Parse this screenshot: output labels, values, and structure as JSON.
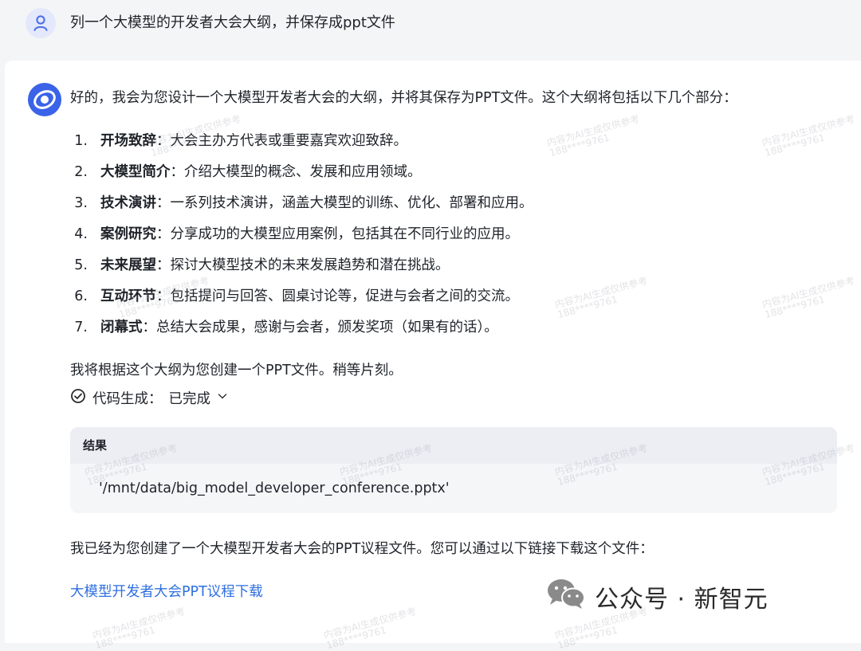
{
  "user": {
    "message": "列一个大模型的开发者大会大纲，并保存成ppt文件"
  },
  "assistant": {
    "intro": "好的，我会为您设计一个大模型开发者大会的大纲，并将其保存为PPT文件。这个大纲将包括以下几个部分：",
    "outline": [
      {
        "num": "1.",
        "term": "开场致辞",
        "desc": "：大会主办方代表或重要嘉宾欢迎致辞。"
      },
      {
        "num": "2.",
        "term": "大模型简介",
        "desc": "：介绍大模型的概念、发展和应用领域。"
      },
      {
        "num": "3.",
        "term": "技术演讲",
        "desc": "：一系列技术演讲，涵盖大模型的训练、优化、部署和应用。"
      },
      {
        "num": "4.",
        "term": "案例研究",
        "desc": "：分享成功的大模型应用案例，包括其在不同行业的应用。"
      },
      {
        "num": "5.",
        "term": "未来展望",
        "desc": "：探讨大模型技术的未来发展趋势和潜在挑战。"
      },
      {
        "num": "6.",
        "term": "互动环节",
        "desc": "：包括提问与回答、圆桌讨论等，促进与会者之间的交流。"
      },
      {
        "num": "7.",
        "term": "闭幕式",
        "desc": "：总结大会成果，感谢与会者，颁发奖项（如果有的话）。"
      }
    ],
    "wait_text": "我将根据这个大纲为您创建一个PPT文件。稍等片刻。",
    "code_status": {
      "label": "代码生成：",
      "value": "已完成"
    },
    "result": {
      "header": "结果",
      "output": "'/mnt/data/big_model_developer_conference.pptx'"
    },
    "done_text": "我已经为您创建了一个大模型开发者大会的PPT议程文件。您可以通过以下链接下载这个文件：",
    "download_link": "大模型开发者大会PPT议程下载"
  },
  "watermark": {
    "line1": "内容为AI生成仅供参考",
    "line2": "188****9761"
  },
  "brand": {
    "text": "公众号 · 新智元"
  },
  "colors": {
    "link": "#2f6fe0",
    "bot_avatar": "#3a63e8",
    "page_bg": "#f4f5f7"
  }
}
